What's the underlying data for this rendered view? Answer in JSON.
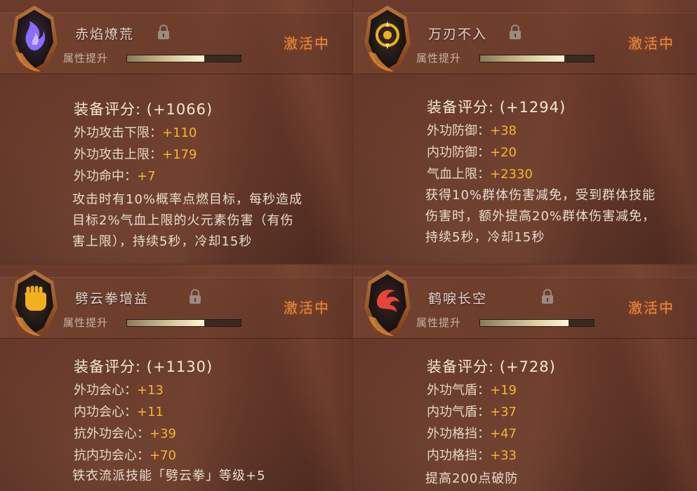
{
  "cards": [
    {
      "name": "赤焰燎荒",
      "attr_label": "属性提升",
      "status": "激活中",
      "progress": 0.68,
      "score_label": "装备评分:",
      "score_value": "(+1066)",
      "stats": [
        {
          "label": "外功攻击下限：",
          "value": "+110"
        },
        {
          "label": "外功攻击上限：",
          "value": "+179"
        },
        {
          "label": "外功命中：",
          "value": "+7"
        }
      ],
      "desc": [
        "攻击时有10%概率点燃目标，每秒造成",
        "目标2%气血上限的火元素伤害（有伤",
        "害上限），持续5秒，冷却15秒"
      ],
      "emblem_color": "#8a6cff",
      "emblem_icon": "purple-flame-emblem-icon"
    },
    {
      "name": "万刃不入",
      "attr_label": "属性提升",
      "status": "激活中",
      "progress": 0.74,
      "score_label": "装备评分:",
      "score_value": "(+1294)",
      "stats": [
        {
          "label": "外功防御：",
          "value": "+38"
        },
        {
          "label": "内功防御：",
          "value": "+20"
        },
        {
          "label": "气血上限：",
          "value": "+2330"
        }
      ],
      "desc": [
        "获得10%群体伤害减免，受到群体技能",
        "伤害时，额外提高20%群体伤害减免，",
        "持续5秒，冷却15秒"
      ],
      "emblem_color": "#f2b020",
      "emblem_icon": "golden-ring-emblem-icon"
    },
    {
      "name": "劈云拳增益",
      "attr_label": "属性提升",
      "status": "激活中",
      "progress": 0.68,
      "score_label": "装备评分:",
      "score_value": "(+1130)",
      "stats": [
        {
          "label": "外功会心：",
          "value": "+13"
        },
        {
          "label": "内功会心：",
          "value": "+11"
        },
        {
          "label": "抗外功会心：",
          "value": "+39"
        },
        {
          "label": "抗内功会心：",
          "value": "+70"
        }
      ],
      "desc": [
        "铁衣流派技能「劈云拳」等级+5"
      ],
      "emblem_color": "#f2b020",
      "emblem_icon": "golden-fist-emblem-icon"
    },
    {
      "name": "鹤唳长空",
      "attr_label": "属性提升",
      "status": "激活中",
      "progress": 0.78,
      "score_label": "装备评分:",
      "score_value": "(+728)",
      "stats": [
        {
          "label": "外功气盾：",
          "value": "+19"
        },
        {
          "label": "内功气盾：",
          "value": "+37"
        },
        {
          "label": "外功格挡：",
          "value": "+47"
        },
        {
          "label": "内功格挡：",
          "value": "+33"
        }
      ],
      "desc": [
        "提高200点破防"
      ],
      "emblem_color": "#e8453a",
      "emblem_icon": "red-crane-emblem-icon"
    }
  ]
}
